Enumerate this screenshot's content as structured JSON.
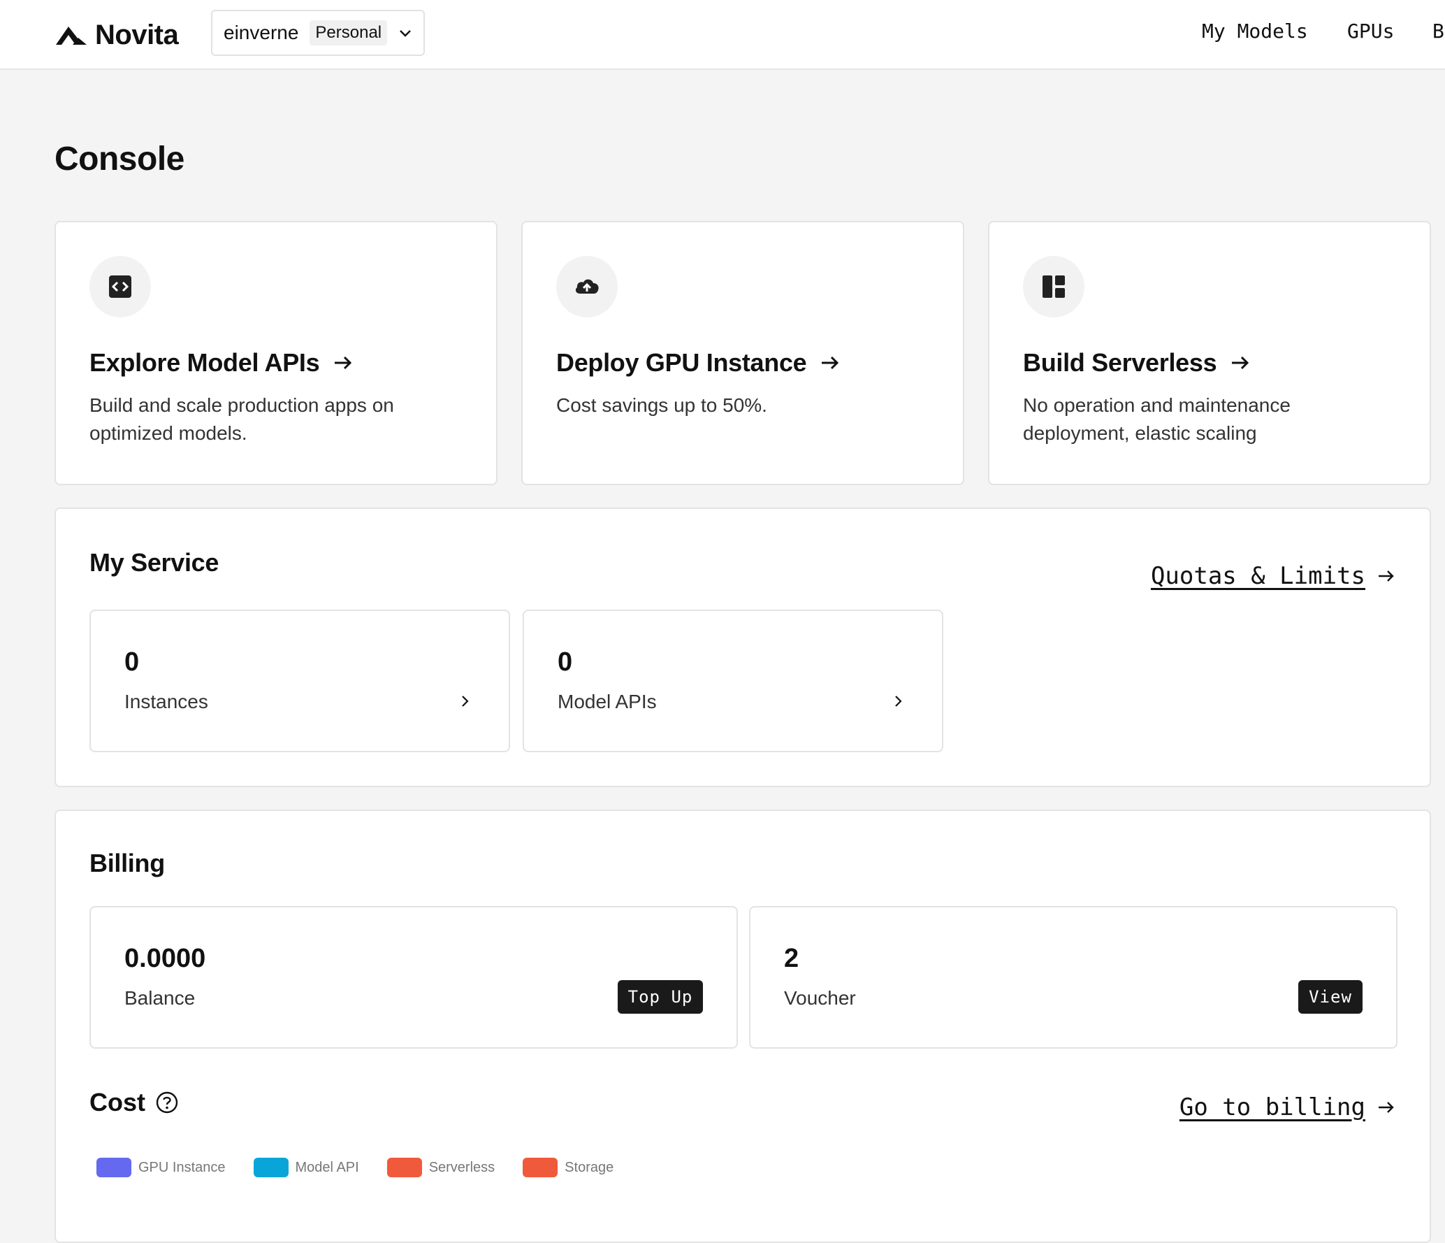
{
  "header": {
    "logo_text": "Novita",
    "account_name": "einverne",
    "account_type": "Personal",
    "nav": [
      "My Models",
      "GPUs",
      "B"
    ]
  },
  "page_title": "Console",
  "quick_actions": [
    {
      "title": "Explore Model APIs",
      "desc": "Build and scale production apps on optimized models.",
      "icon": "code-icon"
    },
    {
      "title": "Deploy GPU Instance",
      "desc": "Cost savings up to 50%.",
      "icon": "cloud-upload-icon"
    },
    {
      "title": "Build Serverless",
      "desc": "No operation and maintenance deployment, elastic scaling",
      "icon": "dashboard-layout-icon"
    }
  ],
  "my_service": {
    "title": "My Service",
    "quotas_link": "Quotas & Limits",
    "stats": [
      {
        "value": "0",
        "label": "Instances"
      },
      {
        "value": "0",
        "label": "Model APIs"
      }
    ]
  },
  "billing": {
    "title": "Billing",
    "balance": {
      "value": "0.0000",
      "label": "Balance",
      "button": "Top Up"
    },
    "voucher": {
      "value": "2",
      "label": "Voucher",
      "button": "View"
    },
    "cost_title": "Cost",
    "billing_link": "Go to billing",
    "legend": [
      {
        "label": "GPU Instance",
        "color": "#6469f0"
      },
      {
        "label": "Model API",
        "color": "#0aa5d8"
      },
      {
        "label": "Serverless",
        "color": "#f05a3c"
      },
      {
        "label": "Storage",
        "color": "#f05a3c"
      }
    ]
  }
}
